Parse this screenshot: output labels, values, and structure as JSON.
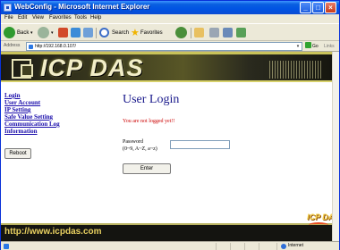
{
  "window": {
    "title": "WebConfig - Microsoft Internet Explorer",
    "controls": {
      "minimize": "_",
      "maximize": "□",
      "close": "×"
    }
  },
  "menu": [
    {
      "label": "File"
    },
    {
      "label": "Edit"
    },
    {
      "label": "View"
    },
    {
      "label": "Favorites"
    },
    {
      "label": "Tools"
    },
    {
      "label": "Help"
    }
  ],
  "toolbar": {
    "back_label": "Back",
    "search_label": "Search",
    "favorites_label": "Favorites",
    "icons": [
      "back-icon",
      "forward-icon",
      "stop-icon",
      "refresh-icon",
      "home-icon",
      "search-icon",
      "favorites-icon",
      "history-icon",
      "mail-icon",
      "print-icon"
    ]
  },
  "address": {
    "label": "Address",
    "value": "http://192.168.0.107/",
    "go_label": "Go",
    "links_label": "Links"
  },
  "page": {
    "banner": {
      "brand": "ICP DAS"
    },
    "nav": [
      {
        "label": "Login"
      },
      {
        "label": "User Account"
      },
      {
        "label": "IP Setting"
      },
      {
        "label": "Safe Value Setting"
      },
      {
        "label": "Communication Log"
      },
      {
        "label": "Information"
      }
    ],
    "reboot_label": "Reboot",
    "login": {
      "title": "User Login",
      "status": "You are not logged yet!!",
      "password_label": "Password",
      "password_hint": "(0~9, A~Z, a~z)",
      "enter_label": "Enter"
    },
    "footer": {
      "url": "http://www.icpdas.com",
      "logo_text": "ICP DAS"
    }
  },
  "statusbar": {
    "zone": "Internet"
  },
  "colors": {
    "title_bar": "#0054e3",
    "link": "#1a0dab",
    "login_title": "#1a1a8c",
    "status_error": "#cc0000",
    "banner_text": "#f2eec8",
    "footer_url": "#e8d060"
  }
}
